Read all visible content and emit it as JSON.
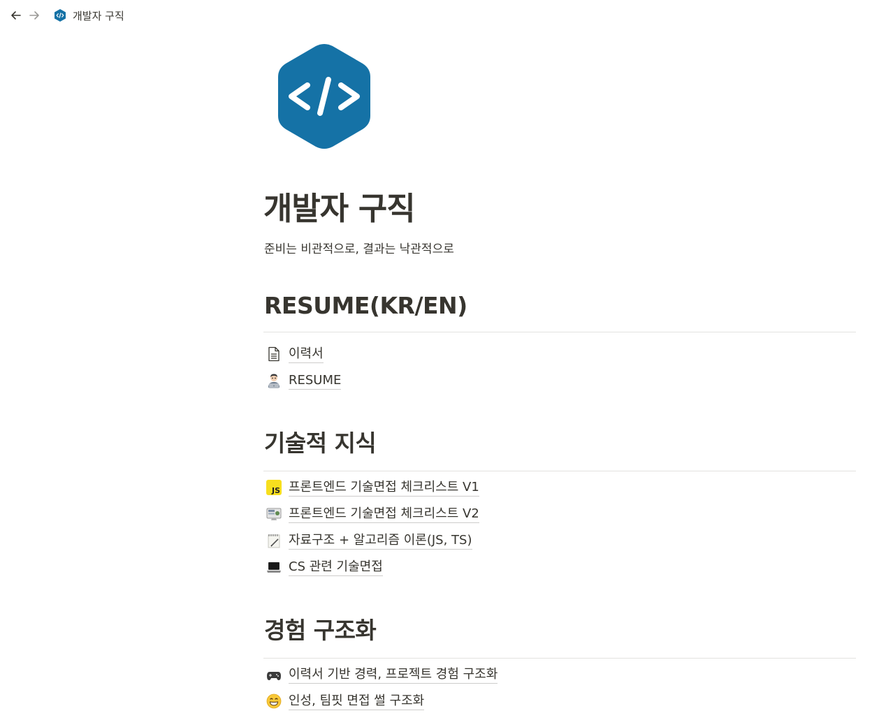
{
  "topbar": {
    "breadcrumb": "개발자 구직"
  },
  "page": {
    "title": "개발자 구직",
    "subtitle": "준비는 비관적으로, 결과는 낙관적으로"
  },
  "sections": [
    {
      "heading": "RESUME(KR/EN)",
      "links": [
        {
          "icon": "document-icon",
          "label": "이력서"
        },
        {
          "icon": "technologist-icon",
          "label": "RESUME"
        }
      ]
    },
    {
      "heading": "기술적 지식",
      "links": [
        {
          "icon": "js-icon",
          "label": "프론트엔드 기술면접 체크리스트 V1"
        },
        {
          "icon": "monitor-icon",
          "label": "프론트엔드 기술면접 체크리스트 V2"
        },
        {
          "icon": "notepad-icon",
          "label": "자료구조 + 알고리즘 이론(JS, TS)"
        },
        {
          "icon": "laptop-icon",
          "label": "CS 관련 기술면접"
        }
      ]
    },
    {
      "heading": "경험 구조화",
      "links": [
        {
          "icon": "gamepad-icon",
          "label": "이력서 기반 경력, 프로젝트 경험 구조화"
        },
        {
          "icon": "grin-icon",
          "label": "인성, 팀핏 면접 썰 구조화"
        }
      ]
    }
  ],
  "colors": {
    "text": "#37352f",
    "brand_blue": "#1572a6",
    "divider": "#e3e2e0"
  }
}
